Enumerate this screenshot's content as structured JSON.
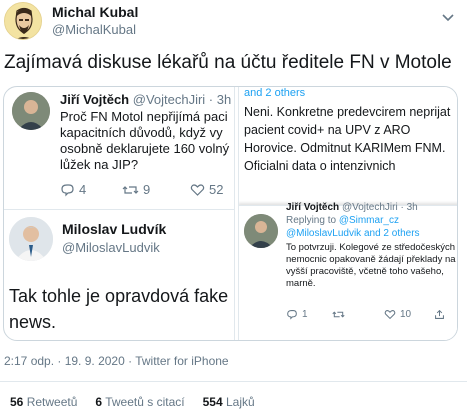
{
  "author": {
    "name": "Michal Kubal",
    "handle": "@MichalKubal"
  },
  "tweet": {
    "text": "Zajímavá diskuse lékařů na účtu ředitele FN v Motole"
  },
  "media": {
    "left": {
      "reply_name": "Jiří Vojtěch",
      "reply_handle": "@VojtechJiri · 3h",
      "reply_text": "Proč FN Motol nepřijímá paci kapacitních důvodů, když vy osobně deklarujete 160 volný lůžek na JIP?",
      "reply_actions": {
        "replies": "4",
        "retweets": "9",
        "likes": "52"
      },
      "quote_name": "Miloslav Ludvík",
      "quote_handle": "@MiloslavLudvik",
      "quote_text": "Tak tohle je opravdová fake news."
    },
    "right": {
      "top_text": "and 2 others",
      "main_text": "Neni. Konkretne predevcirem neprijat pacient covid+ na UPV z ARO Horovice. Odmitnut KARIMem FNM. Oficialni data o intenzivnich",
      "card_name": "Jiří Vojtěch",
      "card_handle": "@VojtechJiri · 3h",
      "card_replying_prefix": "Replying to",
      "card_replying_to": "@Simmar_cz @MiloslavLudvik and 2 others",
      "card_text": "To potvrzuji. Kolegové ze středočeských nemocnic opakovaně žádají překlady na vyšší pracoviště, včetně toho vašeho, marně.",
      "card_actions": {
        "replies": "1",
        "retweets": "",
        "likes": "10"
      }
    }
  },
  "meta": {
    "timestamp": "2:17 odp. · 19. 9. 2020 · Twitter for iPhone"
  },
  "stats": {
    "retweets_count": "56",
    "retweets_label": "Retweetů",
    "quotes_count": "6",
    "quotes_label": "Tweetů s citací",
    "likes_count": "554",
    "likes_label": "Lajků"
  },
  "colors": {
    "accent": "#1da1f2",
    "muted": "#657786",
    "text": "#14171a",
    "border": "#e1e8ed"
  }
}
